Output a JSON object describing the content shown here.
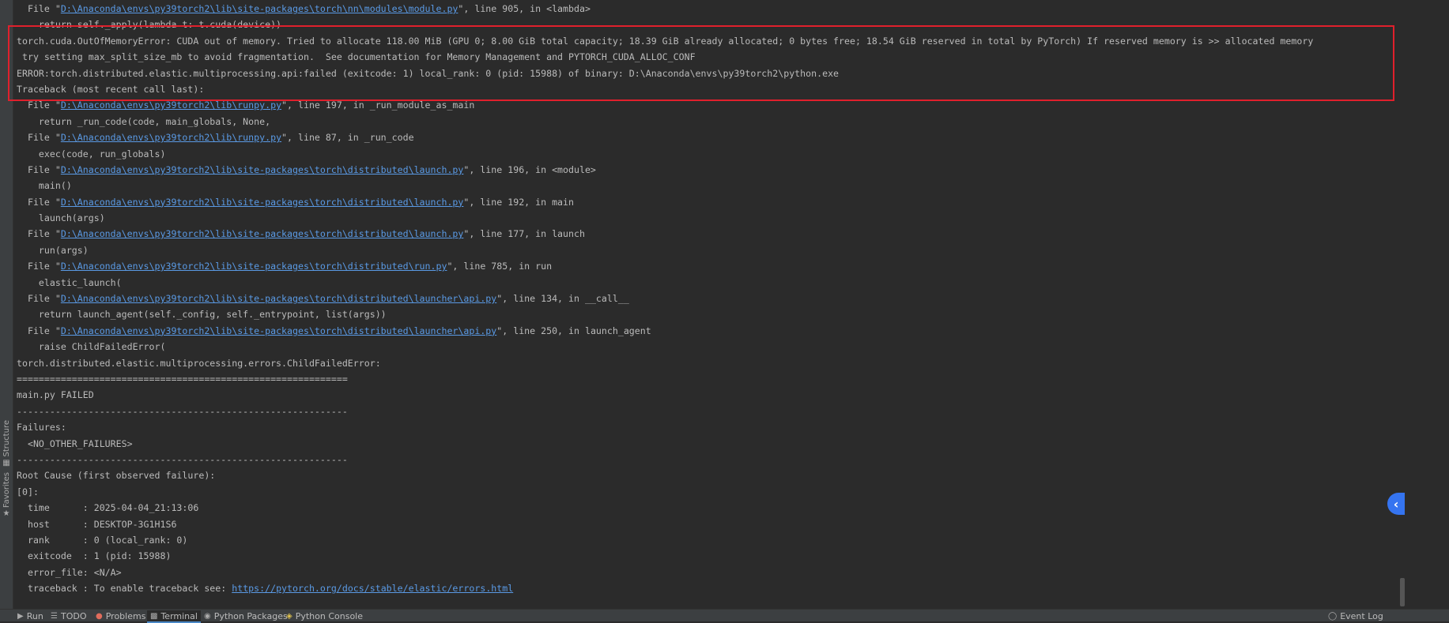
{
  "left_strip": {
    "structure_label": "Structure",
    "favorites_label": "Favorites",
    "structure_icon": "structure-icon",
    "favorites_icon": "star-icon"
  },
  "terminal": {
    "lines": [
      {
        "pre": "  File \"",
        "link": "D:\\Anaconda\\envs\\py39torch2\\lib\\site-packages\\torch\\nn\\modules\\module.py",
        "post": "\", line 905, in <lambda>"
      },
      {
        "text": "    return self._apply(lambda t: t.cuda(device))"
      },
      {
        "text": "torch.cuda.OutOfMemoryError: CUDA out of memory. Tried to allocate 118.00 MiB (GPU 0; 8.00 GiB total capacity; 18.39 GiB already allocated; 0 bytes free; 18.54 GiB reserved in total by PyTorch) If reserved memory is >> allocated memory"
      },
      {
        "text": " try setting max_split_size_mb to avoid fragmentation.  See documentation for Memory Management and PYTORCH_CUDA_ALLOC_CONF"
      },
      {
        "text": "ERROR:torch.distributed.elastic.multiprocessing.api:failed (exitcode: 1) local_rank: 0 (pid: 15988) of binary: D:\\Anaconda\\envs\\py39torch2\\python.exe"
      },
      {
        "text": "Traceback (most recent call last):"
      },
      {
        "pre": "  File \"",
        "link": "D:\\Anaconda\\envs\\py39torch2\\lib\\runpy.py",
        "post": "\", line 197, in _run_module_as_main"
      },
      {
        "text": "    return _run_code(code, main_globals, None,"
      },
      {
        "pre": "  File \"",
        "link": "D:\\Anaconda\\envs\\py39torch2\\lib\\runpy.py",
        "post": "\", line 87, in _run_code"
      },
      {
        "text": "    exec(code, run_globals)"
      },
      {
        "pre": "  File \"",
        "link": "D:\\Anaconda\\envs\\py39torch2\\lib\\site-packages\\torch\\distributed\\launch.py",
        "post": "\", line 196, in <module>"
      },
      {
        "text": "    main()"
      },
      {
        "pre": "  File \"",
        "link": "D:\\Anaconda\\envs\\py39torch2\\lib\\site-packages\\torch\\distributed\\launch.py",
        "post": "\", line 192, in main"
      },
      {
        "text": "    launch(args)"
      },
      {
        "pre": "  File \"",
        "link": "D:\\Anaconda\\envs\\py39torch2\\lib\\site-packages\\torch\\distributed\\launch.py",
        "post": "\", line 177, in launch"
      },
      {
        "text": "    run(args)"
      },
      {
        "pre": "  File \"",
        "link": "D:\\Anaconda\\envs\\py39torch2\\lib\\site-packages\\torch\\distributed\\run.py",
        "post": "\", line 785, in run"
      },
      {
        "text": "    elastic_launch("
      },
      {
        "pre": "  File \"",
        "link": "D:\\Anaconda\\envs\\py39torch2\\lib\\site-packages\\torch\\distributed\\launcher\\api.py",
        "post": "\", line 134, in __call__"
      },
      {
        "text": "    return launch_agent(self._config, self._entrypoint, list(args))"
      },
      {
        "pre": "  File \"",
        "link": "D:\\Anaconda\\envs\\py39torch2\\lib\\site-packages\\torch\\distributed\\launcher\\api.py",
        "post": "\", line 250, in launch_agent"
      },
      {
        "text": "    raise ChildFailedError("
      },
      {
        "text": "torch.distributed.elastic.multiprocessing.errors.ChildFailedError:"
      },
      {
        "text": "============================================================"
      },
      {
        "text": "main.py FAILED"
      },
      {
        "text": "------------------------------------------------------------"
      },
      {
        "text": "Failures:"
      },
      {
        "text": "  <NO_OTHER_FAILURES>"
      },
      {
        "text": "------------------------------------------------------------"
      },
      {
        "text": "Root Cause (first observed failure):"
      },
      {
        "text": "[0]:"
      },
      {
        "text": "  time      : 2025-04-04_21:13:06"
      },
      {
        "text": "  host      : DESKTOP-3G1H1S6"
      },
      {
        "text": "  rank      : 0 (local_rank: 0)"
      },
      {
        "text": "  exitcode  : 1 (pid: 15988)"
      },
      {
        "text": "  error_file: <N/A>"
      },
      {
        "pre": "  traceback : To enable traceback see: ",
        "link": "https://pytorch.org/docs/stable/elastic/errors.html",
        "post": ""
      }
    ]
  },
  "bottom_bar": {
    "tabs": [
      {
        "label": "Run",
        "icon": "play-icon"
      },
      {
        "label": "TODO",
        "icon": "list-icon"
      },
      {
        "label": "Problems",
        "icon": "problems-icon"
      },
      {
        "label": "Terminal",
        "icon": "terminal-icon",
        "active": true
      },
      {
        "label": "Python Packages",
        "icon": "packages-icon"
      },
      {
        "label": "Python Console",
        "icon": "python-icon"
      }
    ],
    "event_log": "Event Log"
  },
  "colors": {
    "background": "#2b2b2b",
    "text": "#bbbbbb",
    "link": "#5a9ae5",
    "highlight_border": "#e0202c",
    "accent": "#3574f0"
  }
}
